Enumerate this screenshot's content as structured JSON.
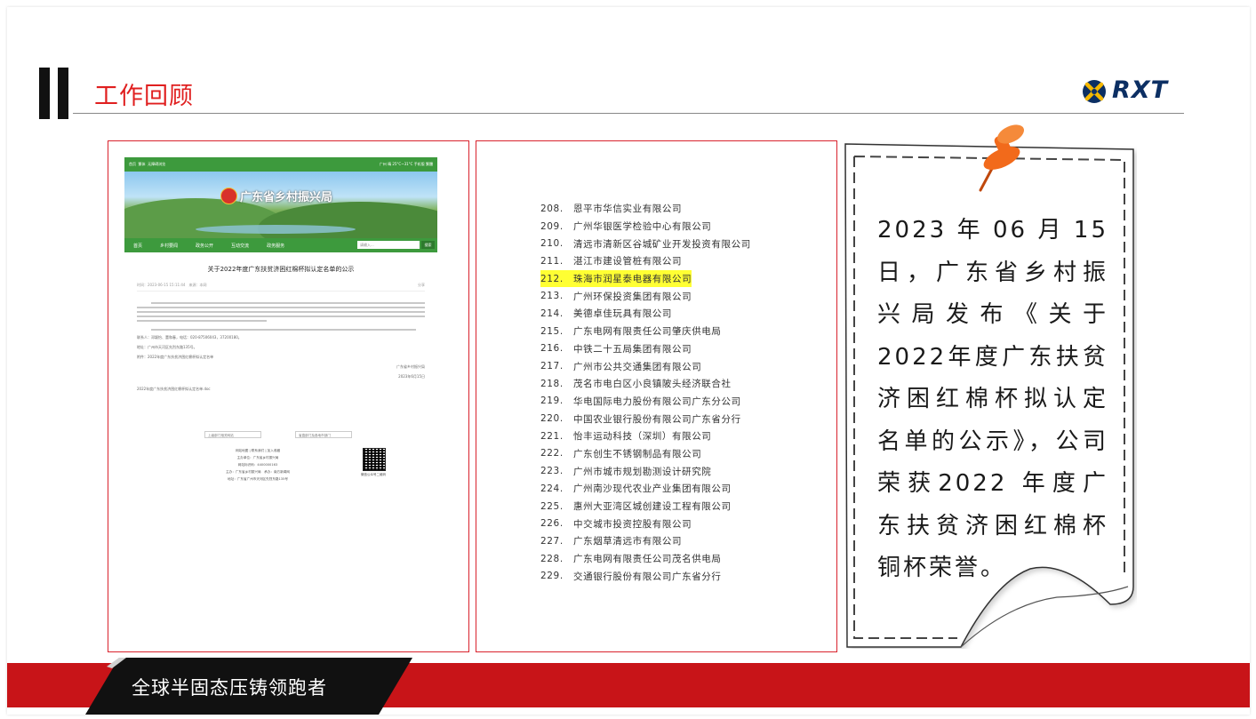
{
  "header": {
    "title": "工作回顾",
    "logo_text": "RXT"
  },
  "website": {
    "top_links": [
      "首页",
      "繁体",
      "无障碍浏览"
    ],
    "top_right": "广州  晴 25°C~31°C  手机版  繁體",
    "site_name": "广东省乡村振兴局",
    "nav": [
      "首页",
      "乡村要闻",
      "政务公开",
      "互动交流",
      "政务服务"
    ],
    "search_placeholder": "请输入...",
    "search_button": "搜索",
    "article_title": "关于2022年度广东扶贫济困红棉杯拟认定名单的公示",
    "article_meta_left": "时间：2023-06-15 15:11:44　来源：本网",
    "article_meta_right": "分享",
    "contact": "联系人：邓颖怡、董和春，电话：020-87506043，37200180。",
    "address": "地址：广州市天河区先烈东路135号。",
    "attachment": "附件：2022年度广东扶贫济困红棉杯拟认定名单",
    "signature_org": "广东省乡村振兴局",
    "signature_date": "2023年6月15日",
    "file_link": "2022年度广东扶贫济困红棉杯拟认定名单.doc",
    "select_1": "上级部门相关网站",
    "select_2": "省直部门及各地市部门",
    "qr_caption": "微信公众号二维码",
    "footer_lines": [
      "网站地图  |  联系我们  |  加入收藏",
      "主办单位：广东省乡村振兴局",
      "网站标识码：4400000163",
      "主办：广东省乡村振兴局　承办：南方新闻网",
      "地址：广东省广州市天河区先烈东路135号"
    ]
  },
  "list": {
    "items": [
      {
        "num": "208.",
        "name": "恩平市华信实业有限公司",
        "highlight": false
      },
      {
        "num": "209.",
        "name": "广州华银医学检验中心有限公司",
        "highlight": false
      },
      {
        "num": "210.",
        "name": "清远市清新区谷城矿业开发投资有限公司",
        "highlight": false
      },
      {
        "num": "211.",
        "name": "湛江市建设管桩有限公司",
        "highlight": false
      },
      {
        "num": "212.",
        "name": "珠海市润星泰电器有限公司",
        "highlight": true
      },
      {
        "num": "213.",
        "name": "广州环保投资集团有限公司",
        "highlight": false
      },
      {
        "num": "214.",
        "name": "美德卓佳玩具有限公司",
        "highlight": false
      },
      {
        "num": "215.",
        "name": "广东电网有限责任公司肇庆供电局",
        "highlight": false
      },
      {
        "num": "216.",
        "name": "中铁二十五局集团有限公司",
        "highlight": false
      },
      {
        "num": "217.",
        "name": "广州市公共交通集团有限公司",
        "highlight": false
      },
      {
        "num": "218.",
        "name": "茂名市电白区小良镇陂头经济联合社",
        "highlight": false
      },
      {
        "num": "219.",
        "name": "华电国际电力股份有限公司广东分公司",
        "highlight": false
      },
      {
        "num": "220.",
        "name": "中国农业银行股份有限公司广东省分行",
        "highlight": false
      },
      {
        "num": "221.",
        "name": "怡丰运动科技（深圳）有限公司",
        "highlight": false
      },
      {
        "num": "222.",
        "name": "广东创生不锈钢制品有限公司",
        "highlight": false
      },
      {
        "num": "223.",
        "name": "广州市城市规划勘测设计研究院",
        "highlight": false
      },
      {
        "num": "224.",
        "name": "广州南沙现代农业产业集团有限公司",
        "highlight": false
      },
      {
        "num": "225.",
        "name": "惠州大亚湾区城创建设工程有限公司",
        "highlight": false
      },
      {
        "num": "226.",
        "name": "中交城市投资控股有限公司",
        "highlight": false
      },
      {
        "num": "227.",
        "name": "广东烟草清远市有限公司",
        "highlight": false
      },
      {
        "num": "228.",
        "name": "广东电网有限责任公司茂名供电局",
        "highlight": false
      },
      {
        "num": "229.",
        "name": "交通银行股份有限公司广东省分行",
        "highlight": false
      }
    ],
    "highlight_color": "#ffff33"
  },
  "note": {
    "text": "2023年06月15日，广东省乡村振兴局发布《关于2022年度广东扶贫济困红棉杯拟认定名单的公示》，公司荣获2022 年度广东扶贫济困红棉杯铜杯荣誉。",
    "pin_color": "#f26a1b"
  },
  "footer": {
    "slogan": "全球半固态压铸领跑者",
    "bar_color": "#c81418"
  }
}
